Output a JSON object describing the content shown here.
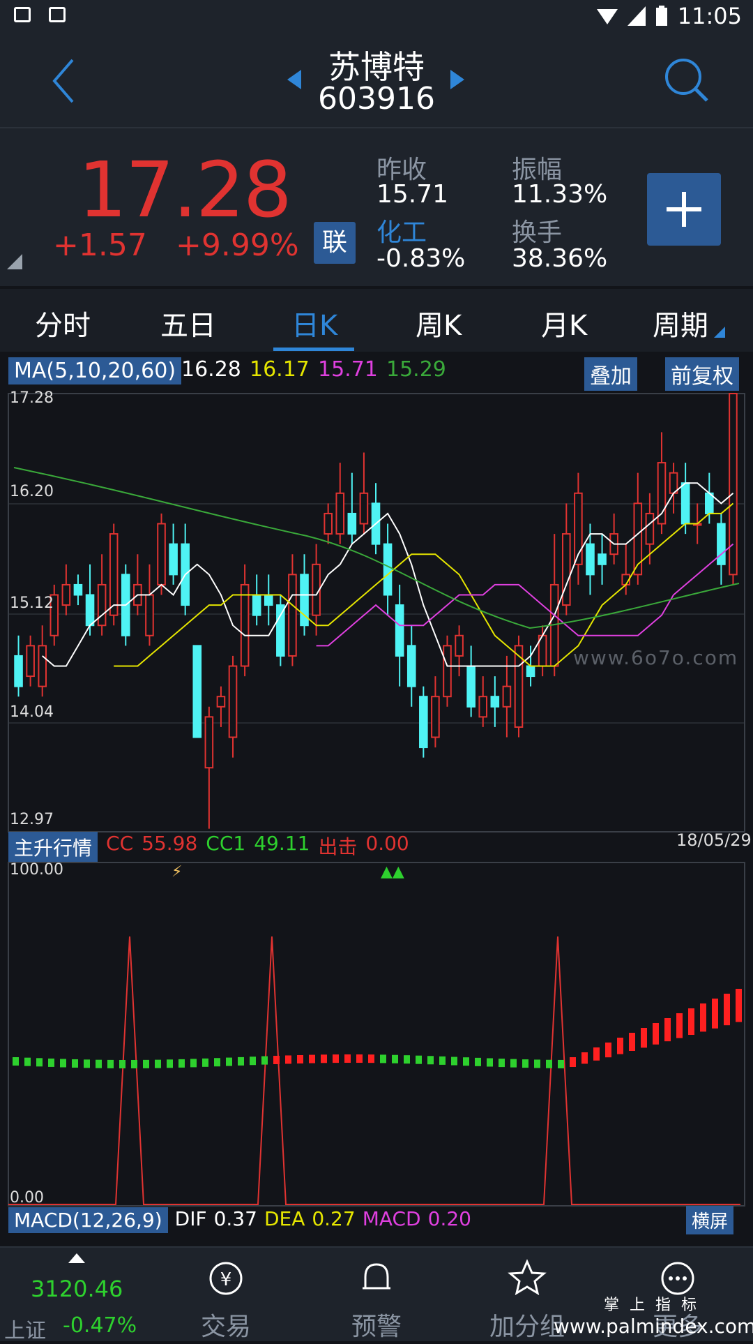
{
  "status": {
    "time": "11:05"
  },
  "header": {
    "name": "苏博特",
    "code": "603916"
  },
  "quote": {
    "price": "17.28",
    "change": "+1.57",
    "change_pct": "+9.99%",
    "lian": "联",
    "prev_close_label": "昨收",
    "prev_close": "15.71",
    "amplitude_label": "振幅",
    "amplitude": "11.33%",
    "sector_label": "化工",
    "sector": "-0.83%",
    "turnover_label": "换手",
    "turnover": "38.36%"
  },
  "tabs": [
    "分时",
    "五日",
    "日K",
    "周K",
    "月K",
    "周期"
  ],
  "active_tab": "日K",
  "ma": {
    "label": "MA(5,10,20,60)",
    "v5": "16.28",
    "v10": "16.17",
    "v20": "15.71",
    "v60": "15.29",
    "overlay_button": "叠加",
    "adjust_button": "前复权"
  },
  "price_axis": [
    "17.28",
    "16.20",
    "15.12",
    "14.04",
    "12.97"
  ],
  "watermark": "www.6o7o.com",
  "indicator": {
    "name": "主升行情",
    "cc_label": "CC",
    "cc": "55.98",
    "cc1_label": "CC1",
    "cc1": "49.11",
    "chuji_label": "出击",
    "chuji": "0.00",
    "date": "18/05/29",
    "axis_top": "100.00",
    "axis_bottom": "0.00"
  },
  "macd": {
    "label": "MACD(12,26,9)",
    "dif_label": "DIF",
    "dif": "0.37",
    "dea_label": "DEA",
    "dea": "0.27",
    "macd_label": "MACD",
    "macd": "0.20",
    "landscape_button": "横屏"
  },
  "nav": {
    "index_value": "3120.46",
    "index_name": "上证",
    "index_change": "-0.47%",
    "items": [
      "交易",
      "预警",
      "加分组",
      "更多"
    ]
  },
  "brand": {
    "cn": "掌 上 指 标",
    "url": "www.palmindex.com"
  },
  "colors": {
    "up": "#e03331",
    "down": "#4ff3f4",
    "ma5": "#ffffff",
    "ma10": "#e6e600",
    "ma20": "#e040e0",
    "ma60": "#3aa93a",
    "accent": "#2f86d8",
    "panel": "#2c5a95"
  },
  "chart_data": {
    "type": "candlestick",
    "ylim": [
      12.97,
      17.28
    ],
    "candles": [
      [
        14.7,
        14.4,
        14.9,
        14.3
      ],
      [
        14.5,
        14.8,
        14.9,
        14.4
      ],
      [
        14.4,
        14.8,
        15.0,
        14.3
      ],
      [
        14.9,
        15.3,
        15.4,
        14.8
      ],
      [
        15.2,
        15.4,
        15.6,
        15.1
      ],
      [
        15.4,
        15.3,
        15.5,
        15.2
      ],
      [
        15.3,
        15.0,
        15.6,
        14.9
      ],
      [
        15.0,
        15.4,
        15.7,
        14.9
      ],
      [
        15.1,
        15.9,
        16.0,
        15.0
      ],
      [
        15.5,
        14.9,
        15.6,
        14.8
      ],
      [
        15.2,
        15.4,
        15.7,
        15.1
      ],
      [
        14.9,
        15.3,
        15.6,
        14.8
      ],
      [
        15.4,
        16.0,
        16.1,
        15.3
      ],
      [
        15.8,
        15.5,
        16.0,
        15.4
      ],
      [
        15.8,
        15.2,
        16.0,
        15.1
      ],
      [
        14.8,
        13.9,
        14.8,
        13.9
      ],
      [
        13.6,
        14.1,
        14.2,
        13.0
      ],
      [
        14.2,
        14.3,
        14.4,
        14.0
      ],
      [
        13.9,
        14.6,
        14.7,
        13.7
      ],
      [
        14.6,
        15.4,
        15.6,
        14.5
      ],
      [
        15.3,
        15.1,
        15.5,
        15.0
      ],
      [
        15.3,
        15.2,
        15.5,
        15.0
      ],
      [
        15.2,
        14.7,
        15.3,
        14.6
      ],
      [
        14.7,
        15.5,
        15.7,
        14.6
      ],
      [
        15.5,
        15.0,
        15.7,
        14.9
      ],
      [
        15.1,
        15.6,
        15.8,
        14.9
      ],
      [
        15.9,
        16.1,
        16.2,
        15.8
      ],
      [
        15.9,
        16.3,
        16.6,
        15.8
      ],
      [
        16.1,
        15.9,
        16.5,
        15.8
      ],
      [
        16.0,
        16.3,
        16.7,
        15.9
      ],
      [
        16.2,
        15.8,
        16.4,
        15.7
      ],
      [
        15.8,
        15.3,
        16.0,
        15.1
      ],
      [
        15.2,
        14.7,
        15.4,
        14.4
      ],
      [
        14.8,
        14.4,
        15.0,
        14.2
      ],
      [
        14.3,
        13.8,
        14.4,
        13.7
      ],
      [
        13.9,
        14.3,
        14.5,
        13.8
      ],
      [
        14.3,
        14.8,
        14.9,
        14.2
      ],
      [
        14.7,
        14.9,
        15.0,
        14.5
      ],
      [
        14.6,
        14.2,
        14.8,
        14.1
      ],
      [
        14.1,
        14.3,
        14.5,
        14.0
      ],
      [
        14.3,
        14.2,
        14.5,
        14.0
      ],
      [
        14.2,
        14.4,
        14.7,
        13.9
      ],
      [
        14.0,
        14.8,
        14.9,
        13.9
      ],
      [
        14.6,
        14.5,
        14.8,
        14.4
      ],
      [
        14.6,
        14.9,
        15.0,
        14.5
      ],
      [
        14.6,
        15.4,
        15.9,
        14.5
      ],
      [
        15.2,
        15.9,
        16.2,
        15.1
      ],
      [
        15.6,
        16.3,
        16.5,
        15.4
      ],
      [
        15.8,
        15.5,
        16.0,
        15.3
      ],
      [
        15.7,
        15.6,
        15.9,
        15.4
      ],
      [
        15.7,
        15.9,
        16.1,
        15.6
      ],
      [
        15.4,
        15.5,
        15.8,
        15.3
      ],
      [
        15.5,
        16.2,
        16.5,
        15.4
      ],
      [
        15.8,
        16.1,
        16.3,
        15.6
      ],
      [
        16.0,
        16.6,
        16.9,
        15.9
      ],
      [
        16.3,
        16.5,
        16.6,
        16.1
      ],
      [
        16.4,
        16.0,
        16.6,
        15.9
      ],
      [
        16.0,
        16.0,
        16.2,
        15.8
      ],
      [
        16.3,
        16.1,
        16.5,
        16.0
      ],
      [
        16.0,
        15.6,
        16.1,
        15.4
      ],
      [
        15.5,
        17.28,
        17.28,
        15.4
      ]
    ],
    "ma5": [
      14.7,
      14.6,
      14.6,
      14.8,
      15.0,
      15.1,
      15.2,
      15.2,
      15.3,
      15.3,
      15.4,
      15.3,
      15.5,
      15.6,
      15.5,
      15.3,
      15.0,
      14.9,
      14.9,
      14.9,
      15.1,
      15.3,
      15.3,
      15.3,
      15.5,
      15.6,
      15.8,
      15.9,
      16.0,
      16.1,
      15.9,
      15.6,
      15.2,
      14.9,
      14.6,
      14.6,
      14.6,
      14.6,
      14.6,
      14.6,
      14.6,
      14.7,
      14.9,
      15.1,
      15.4,
      15.7,
      15.9,
      15.9,
      15.8,
      15.8,
      15.9,
      16.0,
      16.1,
      16.3,
      16.4,
      16.4,
      16.3,
      16.2,
      16.3
    ],
    "ma10": [
      14.6,
      14.6,
      14.6,
      14.7,
      14.8,
      14.9,
      15.0,
      15.1,
      15.2,
      15.2,
      15.3,
      15.3,
      15.3,
      15.3,
      15.3,
      15.2,
      15.1,
      15.0,
      15.0,
      15.1,
      15.2,
      15.3,
      15.4,
      15.5,
      15.6,
      15.7,
      15.7,
      15.7,
      15.6,
      15.5,
      15.3,
      15.1,
      14.9,
      14.8,
      14.7,
      14.6,
      14.6,
      14.6,
      14.7,
      14.8,
      15.0,
      15.2,
      15.3,
      15.4,
      15.6,
      15.7,
      15.8,
      15.9,
      16.0,
      16.0,
      16.1,
      16.1,
      16.2
    ],
    "ma20": [
      14.8,
      14.8,
      14.9,
      15.0,
      15.1,
      15.2,
      15.1,
      15.0,
      15.0,
      15.0,
      15.1,
      15.2,
      15.3,
      15.3,
      15.3,
      15.4,
      15.4,
      15.4,
      15.3,
      15.2,
      15.1,
      15.0,
      14.9,
      14.9,
      14.9,
      14.9,
      14.9,
      14.9,
      15.0,
      15.1,
      15.3,
      15.4,
      15.5,
      15.6,
      15.7,
      15.8
    ]
  }
}
